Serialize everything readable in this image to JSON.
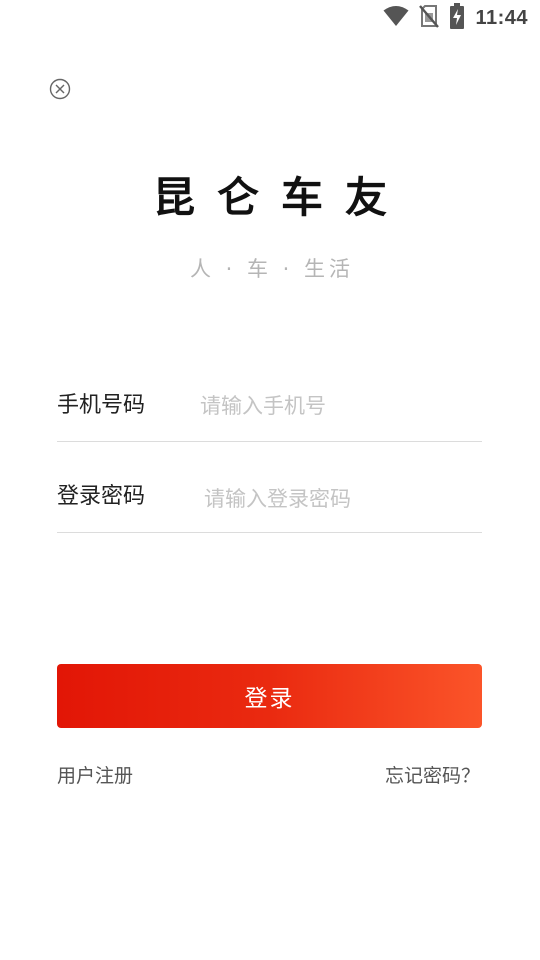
{
  "status_bar": {
    "time": "11:44",
    "icons": [
      "wifi-icon",
      "no-sim-icon",
      "battery-charging-icon"
    ]
  },
  "close_icon": "close-circle-icon",
  "app": {
    "title": "昆仑车友",
    "subtitle": "人 · 车 · 生活"
  },
  "form": {
    "phone": {
      "label": "手机号码",
      "placeholder": "请输入手机号",
      "value": ""
    },
    "password": {
      "label": "登录密码",
      "placeholder": "请输入登录密码",
      "value": ""
    }
  },
  "actions": {
    "login_label": "登录",
    "register_label": "用户注册",
    "forgot_label": "忘记密码？"
  },
  "colors": {
    "button_gradient_start": "#e21606",
    "button_gradient_end": "#fb5429",
    "placeholder": "#c4c4c4",
    "divider": "#dcdcdc"
  }
}
